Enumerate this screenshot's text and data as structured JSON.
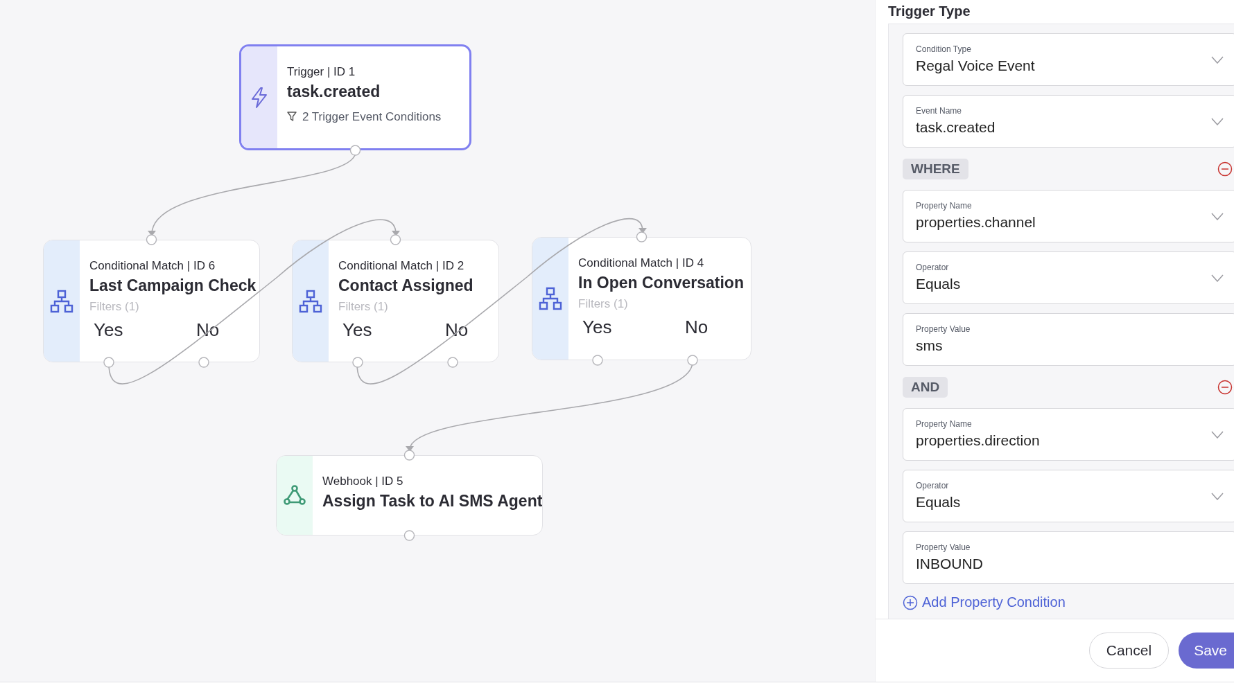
{
  "canvas": {
    "nodes": [
      {
        "kind": "trigger",
        "selected": true,
        "label": "Trigger | ID 1",
        "title": "task.created",
        "detail": "2 Trigger Event Conditions"
      },
      {
        "kind": "conditional",
        "selected": false,
        "label": "Conditional Match | ID 6",
        "title": "Last Campaign Check",
        "detail": "Filters (1)",
        "branches": [
          "Yes",
          "No"
        ]
      },
      {
        "kind": "conditional",
        "selected": false,
        "label": "Conditional Match | ID 2",
        "title": "Contact Assigned",
        "detail": "Filters (1)",
        "branches": [
          "Yes",
          "No"
        ]
      },
      {
        "kind": "conditional",
        "selected": false,
        "label": "Conditional Match | ID 4",
        "title": "In Open Conversation",
        "detail": "Filters (1)",
        "branches": [
          "Yes",
          "No"
        ]
      },
      {
        "kind": "webhook",
        "selected": false,
        "label": "Webhook | ID 5",
        "title": "Assign Task to AI SMS Agent"
      }
    ]
  },
  "panel": {
    "title": "Trigger Type",
    "sections": [
      {
        "kind": "select",
        "label": "Condition Type",
        "value": "Regal Voice Event"
      },
      {
        "kind": "select",
        "label": "Event Name",
        "value": "task.created"
      },
      {
        "kind": "operator",
        "label": "WHERE"
      },
      {
        "kind": "select",
        "label": "Property Name",
        "value": "properties.channel"
      },
      {
        "kind": "select",
        "label": "Operator",
        "value": "Equals"
      },
      {
        "kind": "input",
        "label": "Property Value",
        "value": "sms"
      },
      {
        "kind": "operator",
        "label": "AND"
      },
      {
        "kind": "select",
        "label": "Property Name",
        "value": "properties.direction"
      },
      {
        "kind": "select",
        "label": "Operator",
        "value": "Equals"
      },
      {
        "kind": "input",
        "label": "Property Value",
        "value": "INBOUND"
      }
    ],
    "add_link": "Add Property Condition",
    "buttons": {
      "cancel": "Cancel",
      "save": "Save"
    }
  }
}
